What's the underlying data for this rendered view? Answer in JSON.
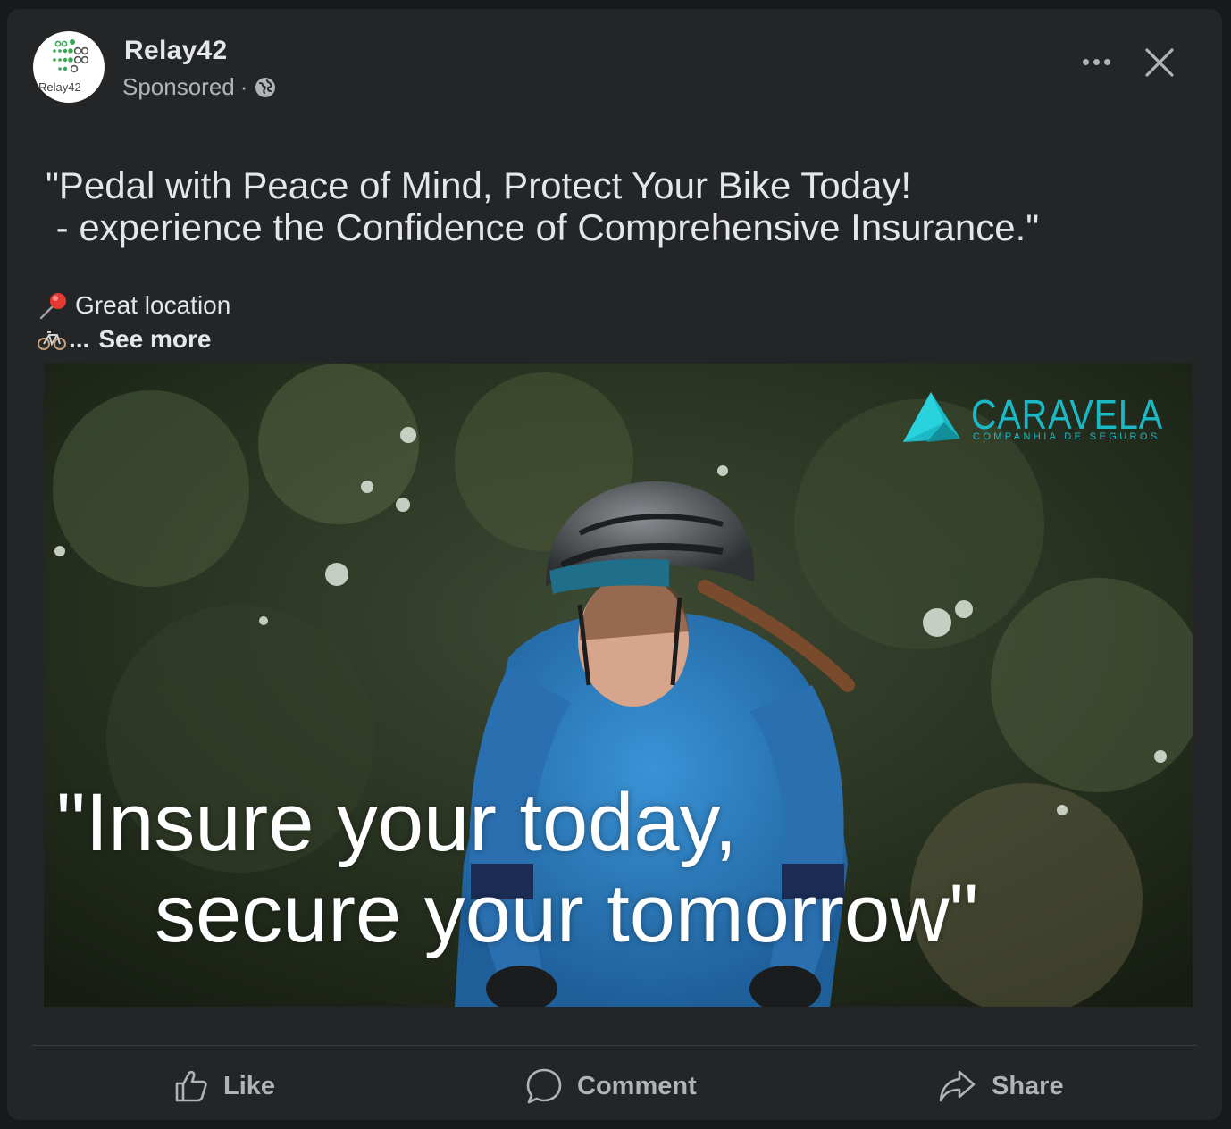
{
  "post": {
    "author": "Relay42",
    "avatar_text": "Relay42",
    "sponsored": "Sponsored",
    "separator": "·",
    "text": "\"Pedal with Peace of Mind, Protect Your Bike Today!\n - experience the Confidence of Comprehensive Insurance.\"",
    "detail_line": "Great location",
    "ellipsis": "...",
    "see_more": "See more"
  },
  "media": {
    "brand_name": "CARAVELA",
    "brand_tagline": "COMPANHIA DE SEGUROS",
    "overlay_line1": "\"Insure your today,",
    "overlay_line2": "secure your tomorrow\""
  },
  "actions": {
    "like": "Like",
    "comment": "Comment",
    "share": "Share"
  },
  "icons": {
    "avatar": "relay42-logo",
    "sponsored": "globe-icon",
    "detail": "pushpin-icon",
    "see_more": "bicycle-icon",
    "more": "more-icon",
    "close": "close-icon",
    "like": "thumbs-up-icon",
    "comment": "comment-icon",
    "share": "share-icon",
    "brand": "caravela-triangle-icon"
  },
  "colors": {
    "card_background": "#242526",
    "page_background": "#18191a",
    "primary_text": "#e4e6eb",
    "secondary_text": "#b0b3b8",
    "brand_accent": "#1bb9c6",
    "avatar_green": "#3aa655"
  }
}
